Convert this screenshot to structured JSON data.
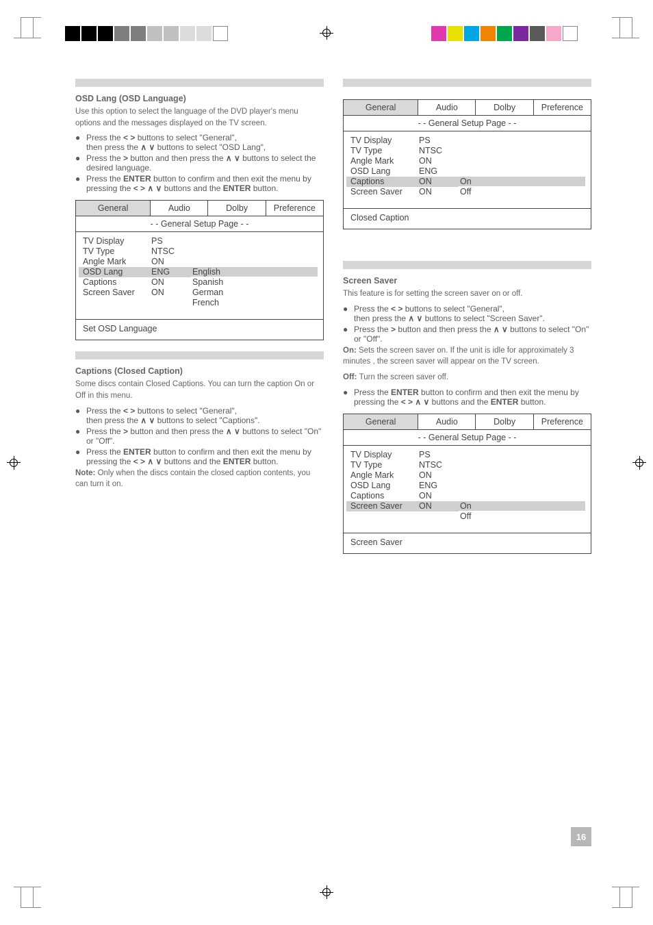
{
  "page_number": "16",
  "print_colors_left": [
    "#000000",
    "#000000",
    "#000000",
    "#7f7f7f",
    "#7f7f7f",
    "#c0c0c0",
    "#c0c0c0",
    "#dcdcdc",
    "#dcdcdc",
    "#ffffff"
  ],
  "print_colors_right": [
    "#e13ab0",
    "#e8e200",
    "#00a6e2",
    "#f08400",
    "#00a64b",
    "#7a2a9e",
    "#5a5a5a",
    "#f7a7c9",
    "#ffffff"
  ],
  "left": {
    "sec1": {
      "title": "OSD Lang (OSD Language)",
      "p1": "Use this option to select the language of the DVD player's menu options and the messages displayed on the TV screen.",
      "b1_a": "Press the ",
      "b1_b": " buttons to select \"General\",",
      "b1_c": "then press the ",
      "b1_d": " buttons to select \"OSD Lang\",",
      "b2_a": "Press the ",
      "b2_b": " button and then press the ",
      "b2_c": " buttons to select the desired language.",
      "b3_a": "Press the ",
      "b3_b": "ENTER",
      "b3_c": " button to confirm and then exit the menu by pressing the ",
      "b3_d": " buttons and the ",
      "b3_e": "ENTER",
      "b3_f": " button."
    },
    "panel1": {
      "tabs": [
        "General",
        "Audio",
        "Dolby",
        "Preference"
      ],
      "head": "- -  General  Setup  Page  - -",
      "items": [
        {
          "k": "TV Display",
          "v": "PS"
        },
        {
          "k": "TV Type",
          "v": "NTSC"
        },
        {
          "k": "Angle Mark",
          "v": "ON"
        },
        {
          "k": "OSD Lang",
          "v": "ENG",
          "sel": true
        },
        {
          "k": "Captions",
          "v": "ON"
        },
        {
          "k": "Screen Saver",
          "v": "ON"
        }
      ],
      "opts": [
        "English",
        "Spanish",
        "German",
        "French"
      ],
      "opt_sel": 0,
      "foot": "Set OSD Language"
    },
    "sec2": {
      "title": "Captions (Closed Caption)",
      "p1": "Some discs contain Closed Captions. You can turn the caption On or Off in this menu.",
      "b1_a": "Press the ",
      "b1_b": " buttons to select \"General\",",
      "b1_c": "then press the ",
      "b1_d": " buttons to select \"Captions\".",
      "b2_a": "Press the ",
      "b2_b": " button and then press the ",
      "b2_c": " buttons to select \"On\" or \"Off\".",
      "b3_a": "Press the ",
      "b3_b": "ENTER",
      "b3_c": " button to confirm and then exit the menu by pressing the ",
      "b3_d": " buttons and the ",
      "b3_e": "ENTER",
      "b3_f": " button.",
      "note_head": "Note: ",
      "note_body": "Only when the discs contain the closed caption contents, you can turn it on."
    }
  },
  "right": {
    "panel2": {
      "tabs": [
        "General",
        "Audio",
        "Dolby",
        "Preference"
      ],
      "head": "- -  General  Setup  Page  - -",
      "items": [
        {
          "k": "TV Display",
          "v": "PS"
        },
        {
          "k": "TV Type",
          "v": "NTSC"
        },
        {
          "k": "Angle Mark",
          "v": "ON"
        },
        {
          "k": "OSD Lang",
          "v": "ENG"
        },
        {
          "k": "Captions",
          "v": "ON",
          "sel": true
        },
        {
          "k": "Screen Saver",
          "v": "ON"
        }
      ],
      "opts": [
        "On",
        "Off"
      ],
      "opt_sel": 0,
      "foot": "Closed Caption"
    },
    "sec3": {
      "title": "Screen Saver",
      "p1": "This feature is for setting the screen saver on or off.",
      "b1_a": "Press the ",
      "b1_b": " buttons to select \"General\",",
      "b1_c": "then press the ",
      "b1_d": " buttons to select \"Screen Saver\".",
      "b2_a": "Press the ",
      "b2_b": " button and then press the ",
      "b2_c": " buttons to select \"On\" or \"Off\".",
      "on_head": "On: ",
      "on_body": "Sets the screen saver on. If the unit is idle for approximately 3 minutes , the screen saver will appear on the TV screen.",
      "off_head": "Off: ",
      "off_body": "Turn the screen saver off.",
      "b3_a": "Press the ",
      "b3_b": "ENTER",
      "b3_c": " button to confirm and then exit the menu by pressing the ",
      "b3_d": " buttons and the ",
      "b3_e": "ENTER",
      "b3_f": " button."
    },
    "panel3": {
      "tabs": [
        "General",
        "Audio",
        "Dolby",
        "Preference"
      ],
      "head": "- -  General  Setup  Page  - -",
      "items": [
        {
          "k": "TV Display",
          "v": "PS"
        },
        {
          "k": "TV Type",
          "v": "NTSC"
        },
        {
          "k": "Angle Mark",
          "v": "ON"
        },
        {
          "k": "OSD Lang",
          "v": "ENG"
        },
        {
          "k": "Captions",
          "v": "ON"
        },
        {
          "k": "Screen Saver",
          "v": "ON",
          "sel": true
        }
      ],
      "opts": [
        "On",
        "Off"
      ],
      "opt_sel": 0,
      "foot": "Screen Saver"
    }
  },
  "sym_lr": "<   >",
  "sym_ud": "∧   ∨",
  "sym_r": ">",
  "sym_lrud": "<   >   ∧   ∨"
}
